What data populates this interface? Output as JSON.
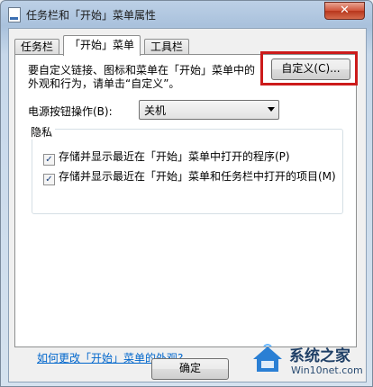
{
  "window": {
    "title": "任务栏和「开始」菜单属性",
    "close_label": "✕"
  },
  "tabs": [
    {
      "label": "任务栏"
    },
    {
      "label": "「开始」菜单"
    },
    {
      "label": "工具栏"
    }
  ],
  "start_menu_tab": {
    "intro_text": "要自定义链接、图标和菜单在「开始」菜单中的外观和行为，请单击“自定义”。",
    "customize_button": "自定义(C)...",
    "power_label": "电源按钮操作(B):",
    "power_value": "关机",
    "privacy_title": "隐私",
    "checkboxes": [
      {
        "label": "存储并显示最近在「开始」菜单中打开的程序(P)",
        "checked": true
      },
      {
        "label": "存储并显示最近在「开始」菜单和任务栏中打开的项目(M)",
        "checked": true
      }
    ],
    "help_link": "如何更改「开始」菜单的外观?"
  },
  "footer": {
    "ok_button": "确定"
  },
  "watermark": {
    "brand": "系统之家",
    "site": "Win10net.com"
  },
  "colors": {
    "highlight": "#cc1b1b",
    "link": "#0066cc",
    "close": "#c8432a"
  }
}
